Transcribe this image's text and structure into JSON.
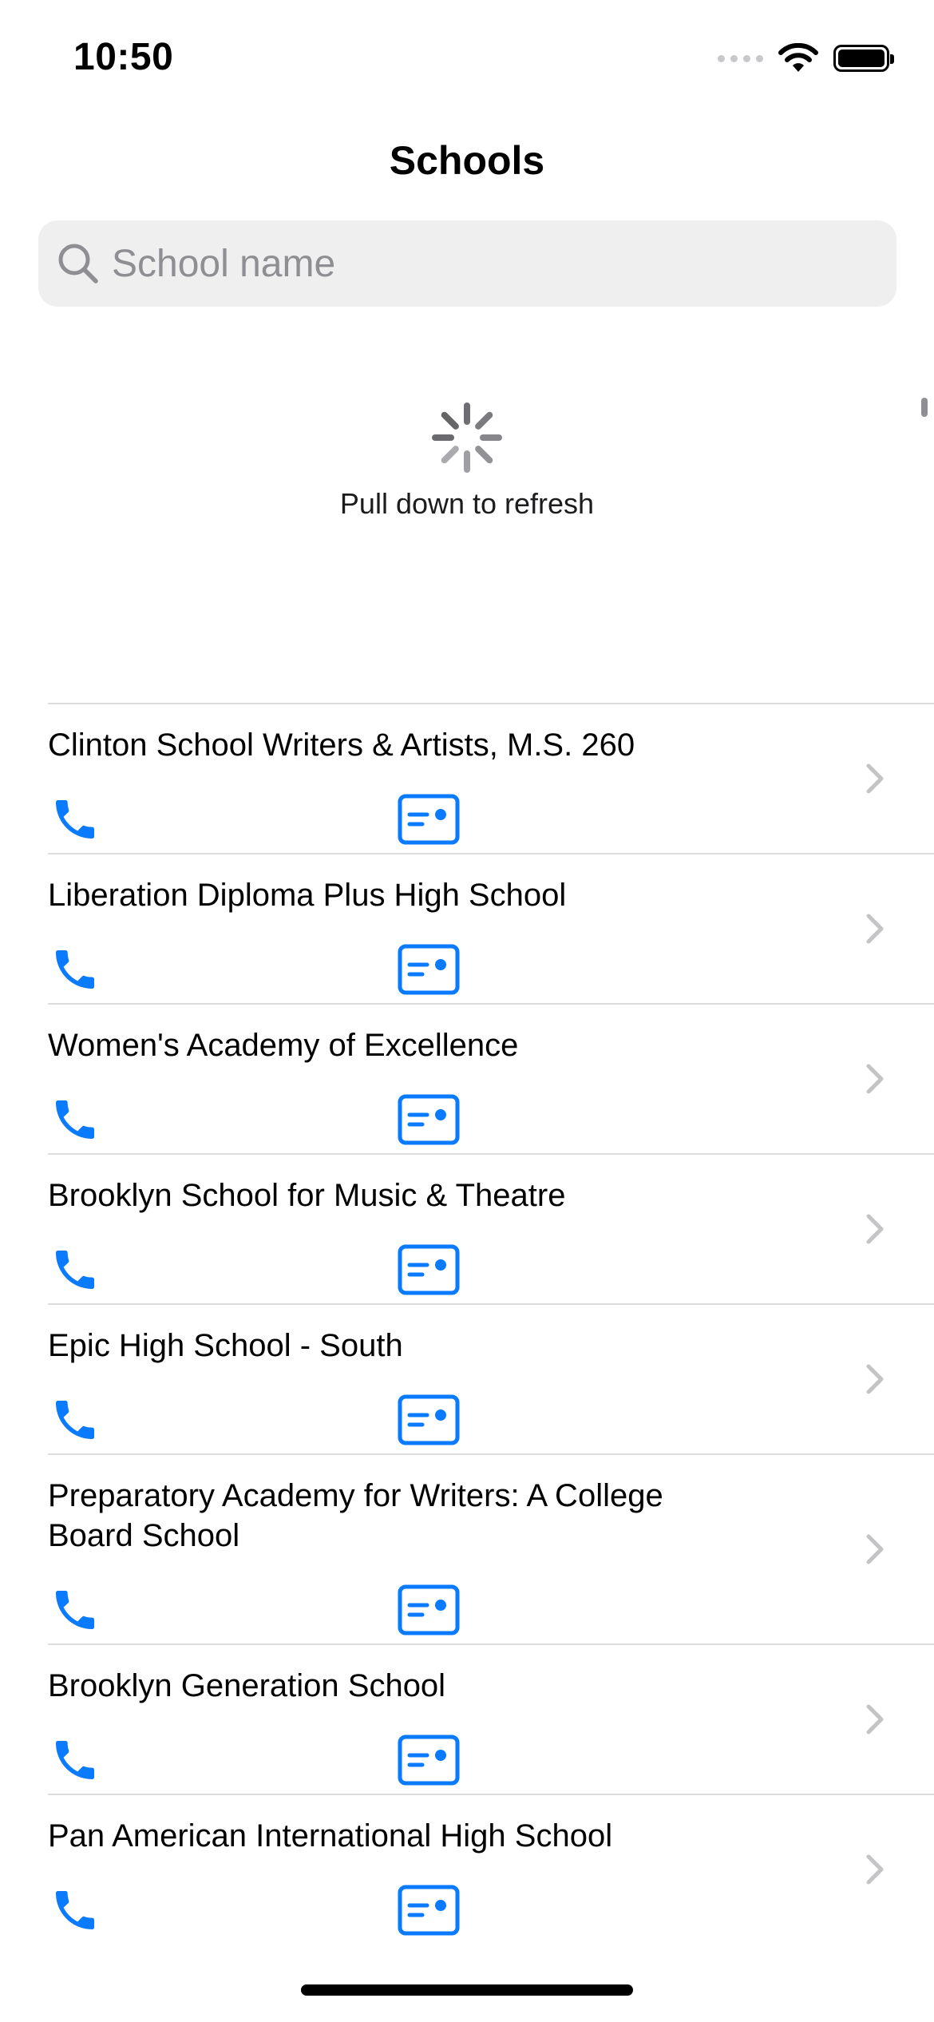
{
  "status_bar": {
    "time": "10:50"
  },
  "nav": {
    "title": "Schools"
  },
  "search": {
    "placeholder": "School name",
    "value": ""
  },
  "refresh": {
    "label": "Pull down to refresh"
  },
  "schools": [
    {
      "name": "Clinton School Writers & Artists, M.S. 260"
    },
    {
      "name": "Liberation Diploma Plus High School"
    },
    {
      "name": "Women's Academy of Excellence"
    },
    {
      "name": "Brooklyn School for Music & Theatre"
    },
    {
      "name": "Epic High School - South"
    },
    {
      "name": "Preparatory Academy for Writers: A College Board School"
    },
    {
      "name": "Brooklyn Generation School"
    },
    {
      "name": "Pan American International High School"
    }
  ],
  "row_icons": {
    "phone": "phone-icon",
    "card": "contact-card-icon",
    "chevron": "chevron-right-icon"
  },
  "colors": {
    "accent": "#0A7AFF",
    "separator": "#DCDCDF",
    "search_bg": "#EFEFEF",
    "chevron": "#C4C4C7"
  }
}
